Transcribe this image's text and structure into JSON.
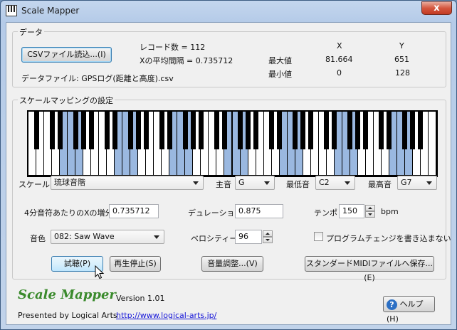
{
  "window": {
    "title": "Scale Mapper",
    "close_label": "x"
  },
  "data_group": {
    "title": "データ",
    "csv_button": "CSVファイル読込...(I)",
    "record_count": "レコード数 = 112",
    "x_interval": "Xの平均間隔 = 0.735712",
    "data_file": "データファイル: GPSログ(距離と高度).csv",
    "col_x": "X",
    "col_y": "Y",
    "max_label": "最大値",
    "min_label": "最小値",
    "max_x": "81.664",
    "max_y": "651",
    "min_x": "0",
    "min_y": "128"
  },
  "mapping_group": {
    "title": "スケールマッピングの設定",
    "scale_label": "スケール",
    "scale_value": "琉球音階",
    "tonic_label": "主音",
    "tonic_value": "G",
    "lowest_label": "最低音",
    "lowest_value": "C2",
    "highest_label": "最高音",
    "highest_value": "G7",
    "quarter_label": "4分音符あたりのXの増分",
    "quarter_value": "0.735712",
    "duration_label": "デュレーション",
    "duration_value": "0.875",
    "tempo_label": "テンポ",
    "tempo_value": "150",
    "tempo_unit": "bpm",
    "tone_label": "音色",
    "tone_value": "082: Saw Wave",
    "velocity_label": "ベロシティー",
    "velocity_value": "96",
    "program_change_label": "プログラムチェンジを書き込まない",
    "program_change_checked": false,
    "highlighted_white_keys": [
      4,
      5,
      6,
      11,
      12,
      13,
      18,
      19,
      20,
      25,
      26,
      27,
      32,
      33,
      34,
      39,
      40,
      41,
      46,
      47,
      48
    ]
  },
  "buttons": {
    "listen": "試聴(P)",
    "stop": "再生停止(S)",
    "volume": "音量調整...(V)",
    "save_midi": "スタンダードMIDIファイルへ保存...(E)",
    "help": "ヘルプ(H)"
  },
  "footer": {
    "logo": "Scale Mapper",
    "version": "Version 1.01",
    "presented": "Presented by Logical Arts",
    "url": "http://www.logical-arts.jp/"
  },
  "colors": {
    "key_highlight": "#9ab8e0",
    "logo_green": "#3a8a2c",
    "link_blue": "#1515d8"
  }
}
